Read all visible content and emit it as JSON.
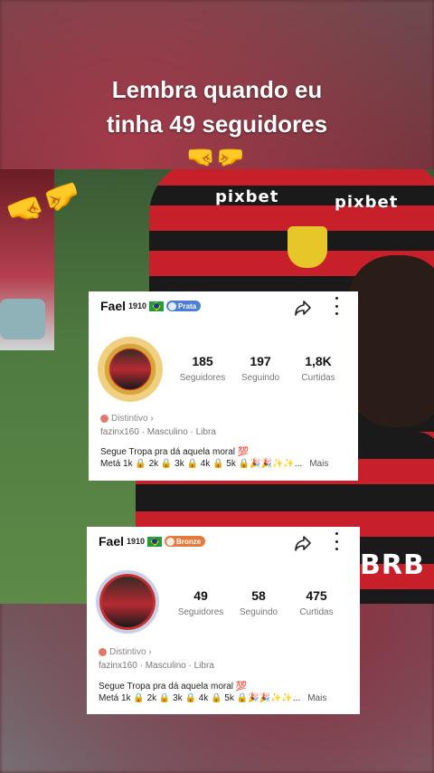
{
  "caption": {
    "line1": "Lembra quando eu",
    "line2": "tinha 49 seguidores",
    "emoji": "🤜🤛"
  },
  "video": {
    "sponsor_left": "pixbet",
    "sponsor_right": "pixbet",
    "sponsor_bottom": "BRB",
    "hands_emoji": "🤜🤛"
  },
  "profile_new": {
    "name": "Fael",
    "name_sup": "1910",
    "tier": "Prata",
    "stats": [
      {
        "value": "185",
        "label": "Seguidores"
      },
      {
        "value": "197",
        "label": "Seguindo"
      },
      {
        "value": "1,8K",
        "label": "Curtidas"
      }
    ],
    "distintivo": "Distintivo ›",
    "meta": "fazinx160  ·  Masculino  ·  Libra",
    "bio_line1": "Segue Tropa pra dá aquela moral 💯",
    "bio_line2": "Metá 1k 🔒 2k 🔒 3k 🔒 4k 🔒 5k 🔒🎉🎉✨✨...",
    "more_label": "Mais"
  },
  "profile_old": {
    "name": "Fael",
    "name_sup": "1910",
    "tier": "Bronze",
    "stats": [
      {
        "value": "49",
        "label": "Seguidores"
      },
      {
        "value": "58",
        "label": "Seguindo"
      },
      {
        "value": "475",
        "label": "Curtidas"
      }
    ],
    "distintivo": "Distintivo ›",
    "meta": "fazinx160  ·  Masculino  ·  Libra",
    "bio_line1": "Segue Tropa pra dá aquela moral 💯",
    "bio_line2": "Metá 1k 🔒 2k 🔒 3k 🔒 4k 🔒 5k 🔒🎉🎉✨✨...",
    "more_label": "Mais"
  }
}
